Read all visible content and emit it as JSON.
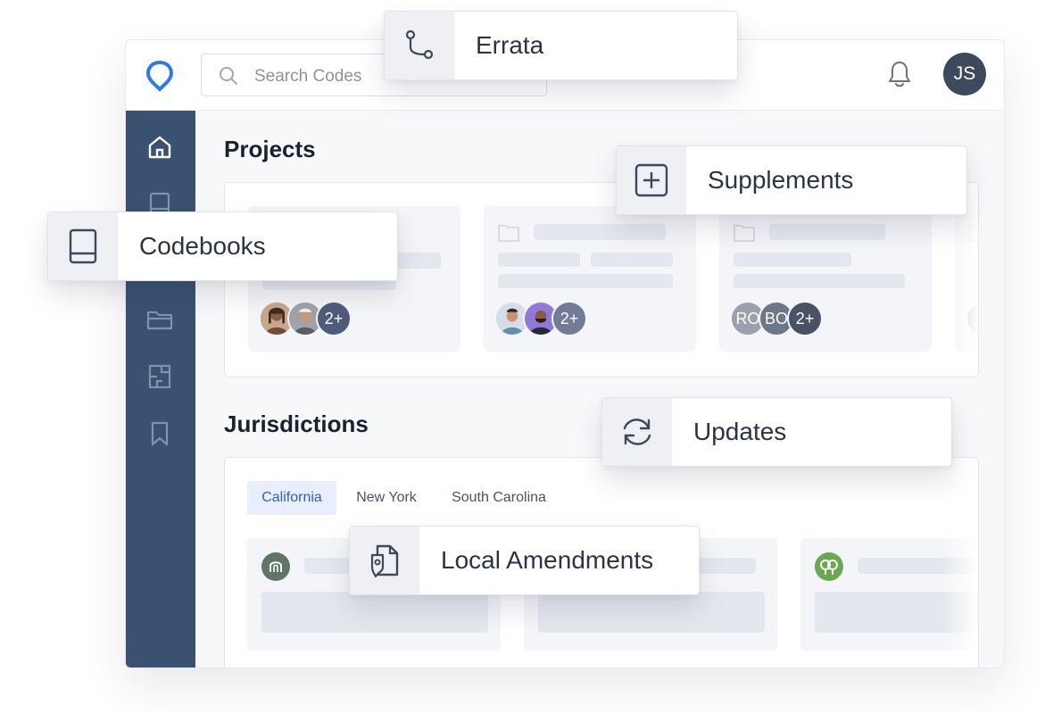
{
  "search": {
    "placeholder": "Search Codes"
  },
  "user": {
    "initials": "JS"
  },
  "sidebar": {
    "items": [
      {
        "icon": "home-icon"
      },
      {
        "icon": "book-icon"
      },
      {
        "icon": "folder-icon"
      },
      {
        "icon": "floorplan-icon"
      },
      {
        "icon": "bookmark-icon"
      }
    ]
  },
  "projects": {
    "title": "Projects",
    "cards": [
      {
        "avatars": [
          "photo",
          "photo"
        ],
        "more": "2+"
      },
      {
        "avatars": [
          "photo",
          "photo"
        ],
        "more": "2+"
      },
      {
        "avatars": [
          "RO",
          "BO"
        ],
        "more": "2+"
      }
    ]
  },
  "jurisdictions": {
    "title": "Jurisdictions",
    "tabs": [
      "California",
      "New York",
      "South Carolina"
    ],
    "active_tab": "California"
  },
  "callouts": {
    "errata": "Errata",
    "supplements": "Supplements",
    "codebooks": "Codebooks",
    "updates": "Updates",
    "local_amendments": "Local Amendments"
  },
  "colors": {
    "sidebar": "#3a5171",
    "accent": "#2f5fbf",
    "logo": "#2e7ce0"
  }
}
